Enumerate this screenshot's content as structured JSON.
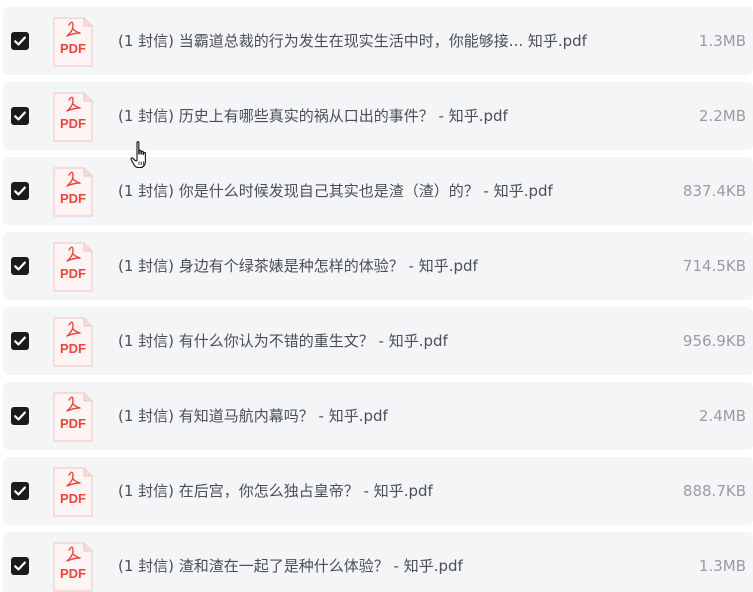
{
  "files": [
    {
      "checked": true,
      "icon_label": "PDF",
      "name": "(1 封信) 当霸道总裁的行为发生在现实生活中时，你能够接... 知乎.pdf",
      "size": "1.3MB"
    },
    {
      "checked": true,
      "icon_label": "PDF",
      "name": "(1 封信) 历史上有哪些真实的祸从口出的事件？ - 知乎.pdf",
      "size": "2.2MB"
    },
    {
      "checked": true,
      "icon_label": "PDF",
      "name": "(1 封信) 你是什么时候发现自己其实也是渣（渣）的？ - 知乎.pdf",
      "size": "837.4KB"
    },
    {
      "checked": true,
      "icon_label": "PDF",
      "name": "(1 封信) 身边有个绿茶婊是种怎样的体验？ - 知乎.pdf",
      "size": "714.5KB"
    },
    {
      "checked": true,
      "icon_label": "PDF",
      "name": "(1 封信) 有什么你认为不错的重生文？ - 知乎.pdf",
      "size": "956.9KB"
    },
    {
      "checked": true,
      "icon_label": "PDF",
      "name": "(1 封信) 有知道马航内幕吗？ - 知乎.pdf",
      "size": "2.4MB"
    },
    {
      "checked": true,
      "icon_label": "PDF",
      "name": "(1 封信) 在后宫，你怎么独占皇帝？ - 知乎.pdf",
      "size": "888.7KB"
    },
    {
      "checked": true,
      "icon_label": "PDF",
      "name": "(1 封信) 渣和渣在一起了是种什么体验？ - 知乎.pdf",
      "size": "1.3MB"
    }
  ],
  "colors": {
    "row_background": "#f4f5f7",
    "checkbox": "#1b1b1b",
    "pdf_red": "#e8463c",
    "name_text": "#4a4f57",
    "size_text": "#9a9ca1"
  },
  "cursor": {
    "icon": "hand-pointer-icon"
  }
}
